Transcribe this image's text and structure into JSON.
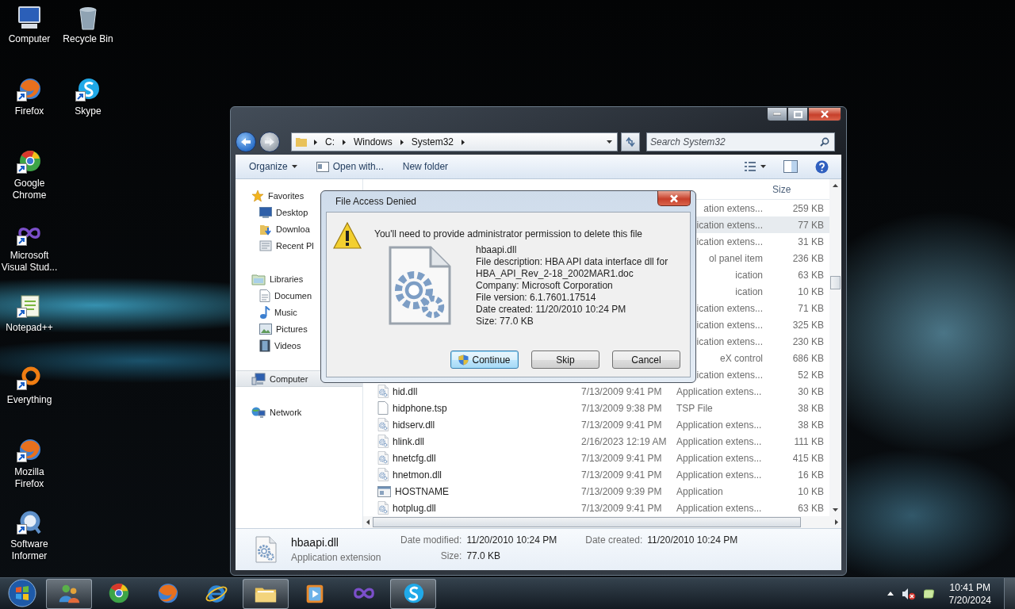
{
  "desktop": {
    "icons": [
      {
        "label": "Computer",
        "kind": "computer",
        "shortcut": false
      },
      {
        "label": "Recycle Bin",
        "kind": "recycle-bin",
        "shortcut": false
      },
      {
        "label": "Firefox",
        "kind": "firefox",
        "shortcut": true
      },
      {
        "label": "Skype",
        "kind": "skype",
        "shortcut": true
      },
      {
        "label": "Google Chrome",
        "kind": "chrome",
        "shortcut": true
      },
      {
        "label": "Microsoft Visual Stud...",
        "kind": "visual-studio",
        "shortcut": true
      },
      {
        "label": "Notepad++",
        "kind": "notepad",
        "shortcut": true
      },
      {
        "label": "Everything",
        "kind": "everything",
        "shortcut": true
      },
      {
        "label": "Mozilla Firefox",
        "kind": "firefox",
        "shortcut": true
      },
      {
        "label": "Software Informer",
        "kind": "informer",
        "shortcut": true
      }
    ]
  },
  "explorer": {
    "breadcrumb": [
      "C:",
      "Windows",
      "System32"
    ],
    "search": {
      "placeholder": "Search System32"
    },
    "toolbar": [
      {
        "label": "Organize",
        "kind": "menu"
      },
      {
        "label": "Open with...",
        "kind": "open"
      },
      {
        "label": "New folder",
        "kind": "plain"
      }
    ],
    "sidebar": {
      "groups": [
        {
          "label": "Favorites",
          "kind": "favorites",
          "selected": false,
          "children": [
            {
              "label": "Desktop",
              "kind": "desktop",
              "selected": false
            },
            {
              "label": "Downloa",
              "kind": "downloads",
              "selected": false
            },
            {
              "label": "Recent Pl",
              "kind": "recent",
              "selected": false
            }
          ]
        },
        {
          "label": "Libraries",
          "kind": "libraries",
          "selected": false,
          "children": [
            {
              "label": "Documen",
              "kind": "documents",
              "selected": false
            },
            {
              "label": "Music",
              "kind": "music",
              "selected": false
            },
            {
              "label": "Pictures",
              "kind": "pictures",
              "selected": false
            },
            {
              "label": "Videos",
              "kind": "videos",
              "selected": false
            }
          ]
        },
        {
          "label": "Computer",
          "kind": "computer",
          "selected": true
        },
        {
          "label": "Network",
          "kind": "network",
          "selected": false
        }
      ]
    },
    "file_list": {
      "size_header": "Size",
      "rows": [
        {
          "kind": "partial",
          "type": "ation extens...",
          "size": "259 KB",
          "selected": false
        },
        {
          "kind": "partial",
          "type": "ication extens...",
          "size": "77 KB",
          "selected": true
        },
        {
          "kind": "partial",
          "type": "ication extens...",
          "size": "31 KB",
          "selected": false
        },
        {
          "kind": "partial",
          "type": "ol panel item",
          "size": "236 KB",
          "selected": false
        },
        {
          "kind": "partial",
          "type": "ication",
          "size": "63 KB",
          "selected": false
        },
        {
          "kind": "partial",
          "type": "ication",
          "size": "10 KB",
          "selected": false
        },
        {
          "kind": "partial",
          "type": "ication extens...",
          "size": "71 KB",
          "selected": false
        },
        {
          "kind": "partial",
          "type": "ication extens...",
          "size": "325 KB",
          "selected": false
        },
        {
          "kind": "partial",
          "type": "ication extens...",
          "size": "230 KB",
          "selected": false
        },
        {
          "kind": "partial",
          "type": "eX control",
          "size": "686 KB",
          "selected": false
        },
        {
          "kind": "partial",
          "type": "ication extens...",
          "size": "52 KB",
          "selected": false
        },
        {
          "kind": "dll",
          "name": "hid.dll",
          "date": "7/13/2009 9:41 PM",
          "type": "Application extens...",
          "size": "30 KB",
          "selected": false
        },
        {
          "kind": "blank",
          "name": "hidphone.tsp",
          "date": "7/13/2009 9:38 PM",
          "type": "TSP File",
          "size": "38 KB",
          "selected": false
        },
        {
          "kind": "dll",
          "name": "hidserv.dll",
          "date": "7/13/2009 9:41 PM",
          "type": "Application extens...",
          "size": "38 KB",
          "selected": false
        },
        {
          "kind": "dll",
          "name": "hlink.dll",
          "date": "2/16/2023 12:19 AM",
          "type": "Application extens...",
          "size": "111 KB",
          "selected": false
        },
        {
          "kind": "dll",
          "name": "hnetcfg.dll",
          "date": "7/13/2009 9:41 PM",
          "type": "Application extens...",
          "size": "415 KB",
          "selected": false
        },
        {
          "kind": "dll",
          "name": "hnetmon.dll",
          "date": "7/13/2009 9:41 PM",
          "type": "Application extens...",
          "size": "16 KB",
          "selected": false
        },
        {
          "kind": "app",
          "name": "HOSTNAME",
          "date": "7/13/2009 9:39 PM",
          "type": "Application",
          "size": "10 KB",
          "selected": false
        },
        {
          "kind": "dll",
          "name": "hotplug.dll",
          "date": "7/13/2009 9:41 PM",
          "type": "Application extens...",
          "size": "63 KB",
          "selected": false
        }
      ]
    },
    "details": {
      "name": "hbaapi.dll",
      "type": "Application extension",
      "fields": [
        {
          "label": "Date modified:",
          "value": "11/20/2010 10:24 PM"
        },
        {
          "label": "Size:",
          "value": "77.0 KB"
        },
        {
          "label": "Date created:",
          "value": "11/20/2010 10:24 PM"
        }
      ]
    }
  },
  "dialog": {
    "title": "File Access Denied",
    "message": "You'll need to provide administrator permission to delete this file",
    "file_info": [
      "hbaapi.dll",
      "File description: HBA API data interface dll for",
      "HBA_API_Rev_2-18_2002MAR1.doc",
      "Company: Microsoft Corporation",
      "File version: 6.1.7601.17514",
      "Date created: 11/20/2010 10:24 PM",
      "Size: 77.0 KB"
    ],
    "buttons": [
      {
        "label": "Continue",
        "kind": "shield",
        "default": true
      },
      {
        "label": "Skip",
        "kind": "plain",
        "default": false
      },
      {
        "label": "Cancel",
        "kind": "plain",
        "default": false
      }
    ]
  },
  "taskbar": {
    "items": [
      {
        "kind": "people",
        "open": true
      },
      {
        "kind": "chrome",
        "open": false
      },
      {
        "kind": "firefox",
        "open": false
      },
      {
        "kind": "ie",
        "open": false
      },
      {
        "kind": "explorer",
        "open": true
      },
      {
        "kind": "media",
        "open": false
      },
      {
        "kind": "visual-studio",
        "open": false
      },
      {
        "kind": "skype",
        "open": true
      }
    ],
    "clock": {
      "time": "10:41 PM",
      "date": "7/20/2024"
    }
  }
}
